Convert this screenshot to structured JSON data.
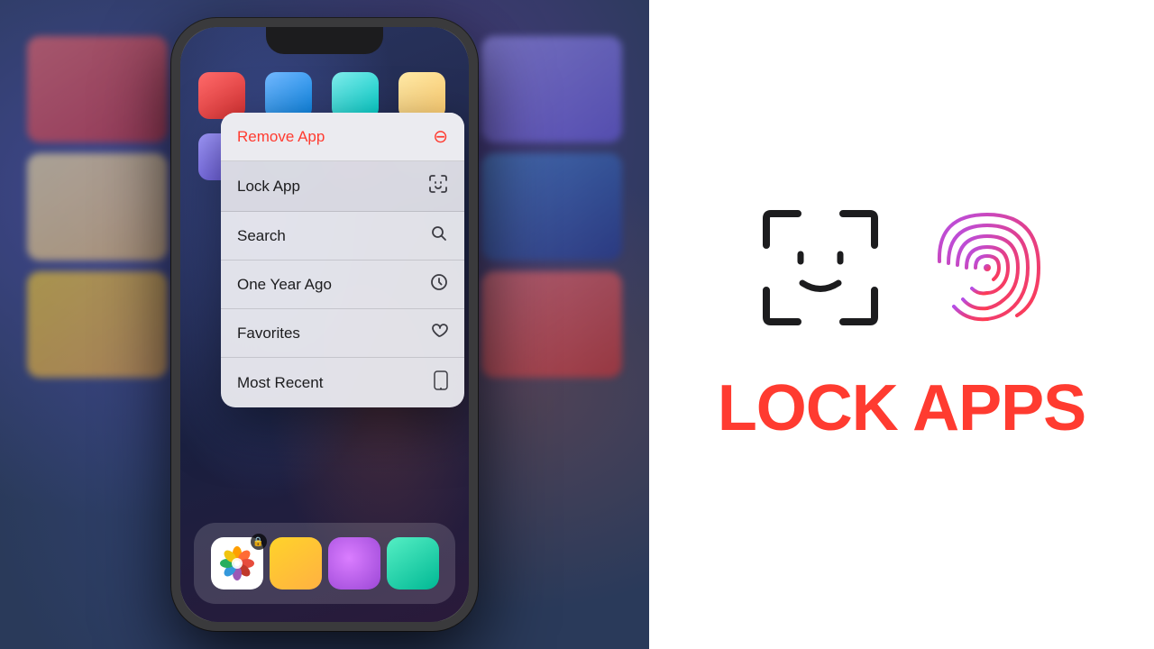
{
  "left": {
    "context_menu": {
      "items": [
        {
          "id": "remove-app",
          "label": "Remove App",
          "icon": "⊖",
          "type": "remove"
        },
        {
          "id": "lock-app",
          "label": "Lock App",
          "icon": "face-id",
          "type": "highlighted"
        },
        {
          "id": "search",
          "label": "Search",
          "icon": "search",
          "type": "normal"
        },
        {
          "id": "one-year-ago",
          "label": "One Year Ago",
          "icon": "clock",
          "type": "normal"
        },
        {
          "id": "favorites",
          "label": "Favorites",
          "icon": "heart",
          "type": "normal"
        },
        {
          "id": "most-recent",
          "label": "Most Recent",
          "icon": "phone",
          "type": "normal"
        }
      ]
    },
    "dock": {
      "photos_label": "Photos"
    }
  },
  "right": {
    "title": "LOCK APPS",
    "title_color": "#ff3b30"
  }
}
